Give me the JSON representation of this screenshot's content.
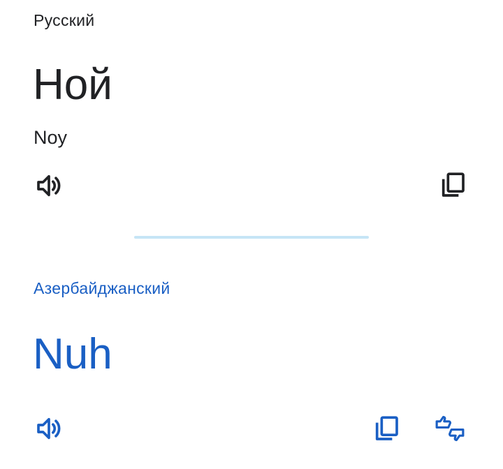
{
  "source": {
    "language": "Русский",
    "text": "Ной",
    "transliteration": "Noy",
    "speak_icon": "speaker-icon",
    "copy_icon": "copy-icon"
  },
  "target": {
    "language": "Азербайджанский",
    "text": "Nuh",
    "speak_icon": "speaker-icon",
    "copy_icon": "copy-icon",
    "feedback_icon": "thumbs-up-down-icon"
  },
  "colors": {
    "source_text": "#202124",
    "target_accent": "#1a5fc4",
    "divider": "#c6e5f6"
  }
}
